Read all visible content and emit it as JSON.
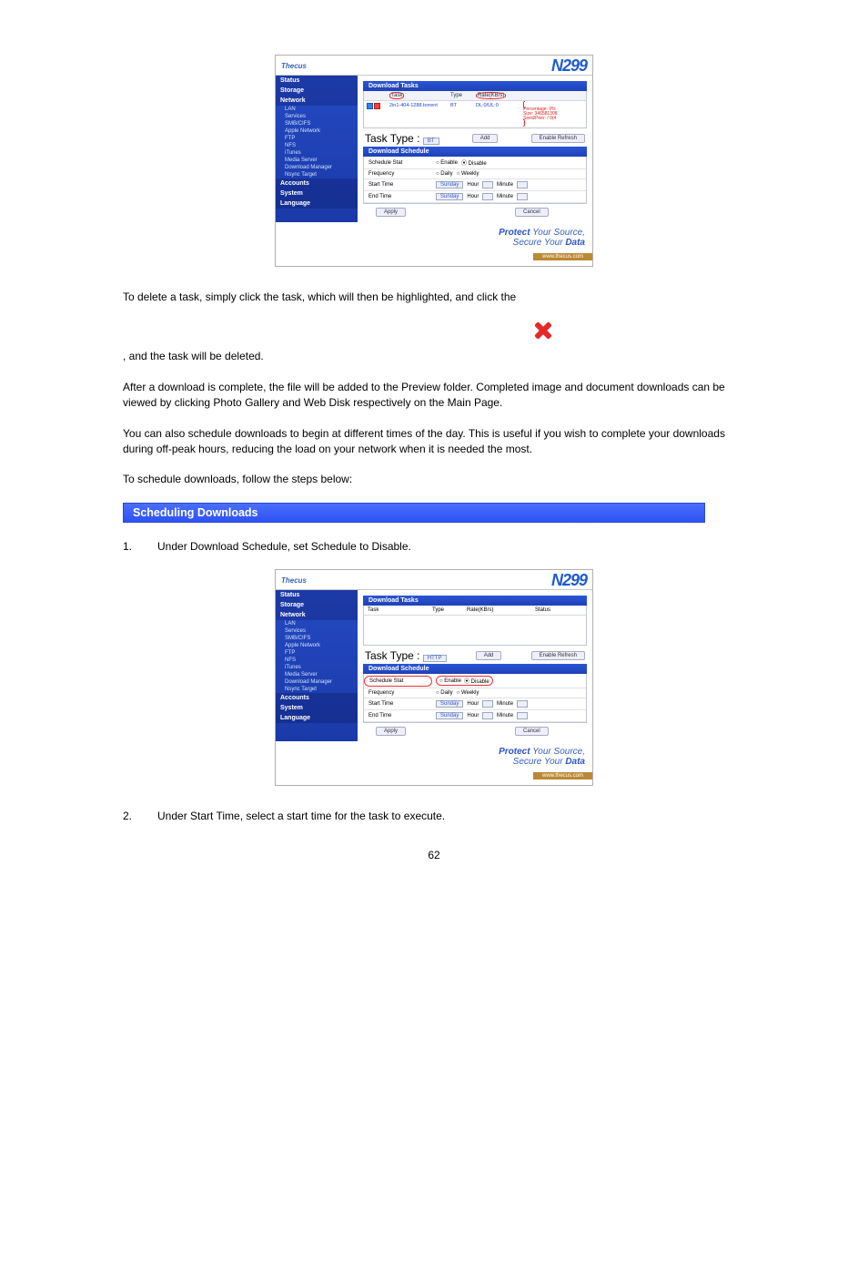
{
  "shots": {
    "brand_model": "N299",
    "logo": "Thecus",
    "sidebar": {
      "groups": [
        {
          "name": "Status",
          "items": []
        },
        {
          "name": "Storage",
          "items": []
        },
        {
          "name": "Network",
          "items": [
            "LAN",
            "Services",
            "SMB/CIFS",
            "Apple Network",
            "FTP",
            "NFS",
            "iTunes",
            "Media Server",
            "Download Manager",
            "Nsync Target"
          ]
        },
        {
          "name": "Accounts",
          "items": []
        },
        {
          "name": "System",
          "items": []
        },
        {
          "name": "Language",
          "items": []
        }
      ]
    },
    "footer_tagline1": "Protect",
    "footer_tagline2": "Your Source,",
    "footer_tagline3": "Secure Your",
    "footer_tagline4": "Data",
    "linkbar": "www.thecus.com"
  },
  "shot1": {
    "tasks_title": "Download Tasks",
    "cols": {
      "c2": "Task",
      "c3": "Type",
      "c4": "Rate(KB/s)",
      "c5": ""
    },
    "row": {
      "taskname": "2in1-404-1288.torrent",
      "type": "BT",
      "rate": "DL:0/UL:0",
      "pct": "Percentage: 0%",
      "size": "Size: 346581308",
      "seed": "Seed/Peer: / 0(4"
    },
    "task_type_label": "Task Type :",
    "task_type_value": "BT",
    "add_btn": "Add",
    "refresh_btn": "Enable Refresh",
    "sched_title": "Download Schedule",
    "sched": {
      "stat_label": "Schedule Stat",
      "enable": "Enable",
      "disable": "Disable",
      "freq_label": "Frequency",
      "daily": "Daily",
      "weekly": "Weekly",
      "start_label": "Start Time",
      "end_label": "End Time",
      "day": "Sunday",
      "hour": "Hour",
      "minute": "Minute"
    },
    "apply": "Apply",
    "cancel": "Cancel"
  },
  "shot2": {
    "tasks_title": "Download Tasks",
    "cols": {
      "t1": "Task",
      "t2": "Type",
      "t3": "Rate(KB/s)",
      "t4": "Status"
    },
    "task_type_label": "Task Type :",
    "task_type_value": "HTTP",
    "add_btn": "Add",
    "refresh_btn": "Enable Refresh",
    "sched_title": "Download Schedule",
    "apply": "Apply",
    "cancel": "Cancel"
  },
  "text": {
    "p1": "To delete a task, simply click the task, which will then be highlighted, and click the",
    "p1b": ", and the task will be deleted.",
    "p2": "After a download is complete, the file will be added to the Preview folder. Completed image and document downloads can be viewed by clicking Photo Gallery and Web Disk respectively on the Main Page.",
    "p3": "You can also schedule downloads to begin at different times of the day. This is useful if you wish to complete your downloads during off-peak hours, reducing the load on your network when it is needed the most.",
    "p4": "To schedule downloads, follow the steps below:",
    "h": "Scheduling Downloads",
    "s1n": "1.",
    "s1": "Under Download Schedule, set Schedule to Disable.",
    "s2n": "2.",
    "s2": "Under Start Time, select a start time for the task to execute.",
    "pagenum": "62"
  }
}
